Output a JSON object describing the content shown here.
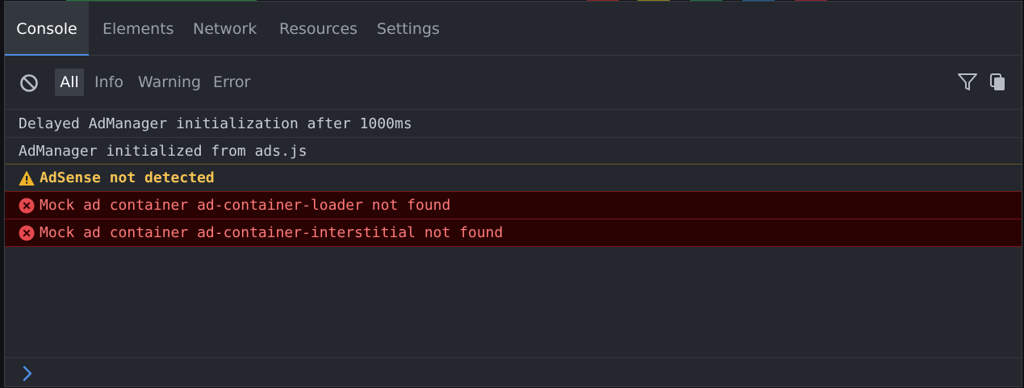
{
  "tabs": [
    {
      "label": "Console",
      "active": true
    },
    {
      "label": "Elements",
      "active": false
    },
    {
      "label": "Network",
      "active": false
    },
    {
      "label": "Resources",
      "active": false
    },
    {
      "label": "Settings",
      "active": false
    }
  ],
  "toolbar": {
    "clear_icon": "clear-console-icon",
    "filters": [
      {
        "label": "All",
        "active": true
      },
      {
        "label": "Info",
        "active": false
      },
      {
        "label": "Warning",
        "active": false
      },
      {
        "label": "Error",
        "active": false
      }
    ],
    "filter_icon": "funnel-icon",
    "copy_icon": "copy-icon"
  },
  "logs": [
    {
      "level": "log",
      "text": "Delayed AdManager initialization after 1000ms"
    },
    {
      "level": "log",
      "text": "AdManager initialized from ads.js"
    },
    {
      "level": "warn",
      "text": "AdSense not detected"
    },
    {
      "level": "error",
      "text": "Mock ad container ad-container-loader not found"
    },
    {
      "level": "error",
      "text": "Mock ad container ad-container-interstitial not found"
    }
  ],
  "input": {
    "prompt_icon": "chevron-right-icon",
    "value": "",
    "placeholder": ""
  },
  "colors": {
    "accent": "#4d8fe8",
    "panel_bg": "#24282e",
    "warning": "#f6c453",
    "error_text": "#ff7a7a",
    "error_bg": "#2b0202",
    "error_icon": "#e5484d"
  }
}
